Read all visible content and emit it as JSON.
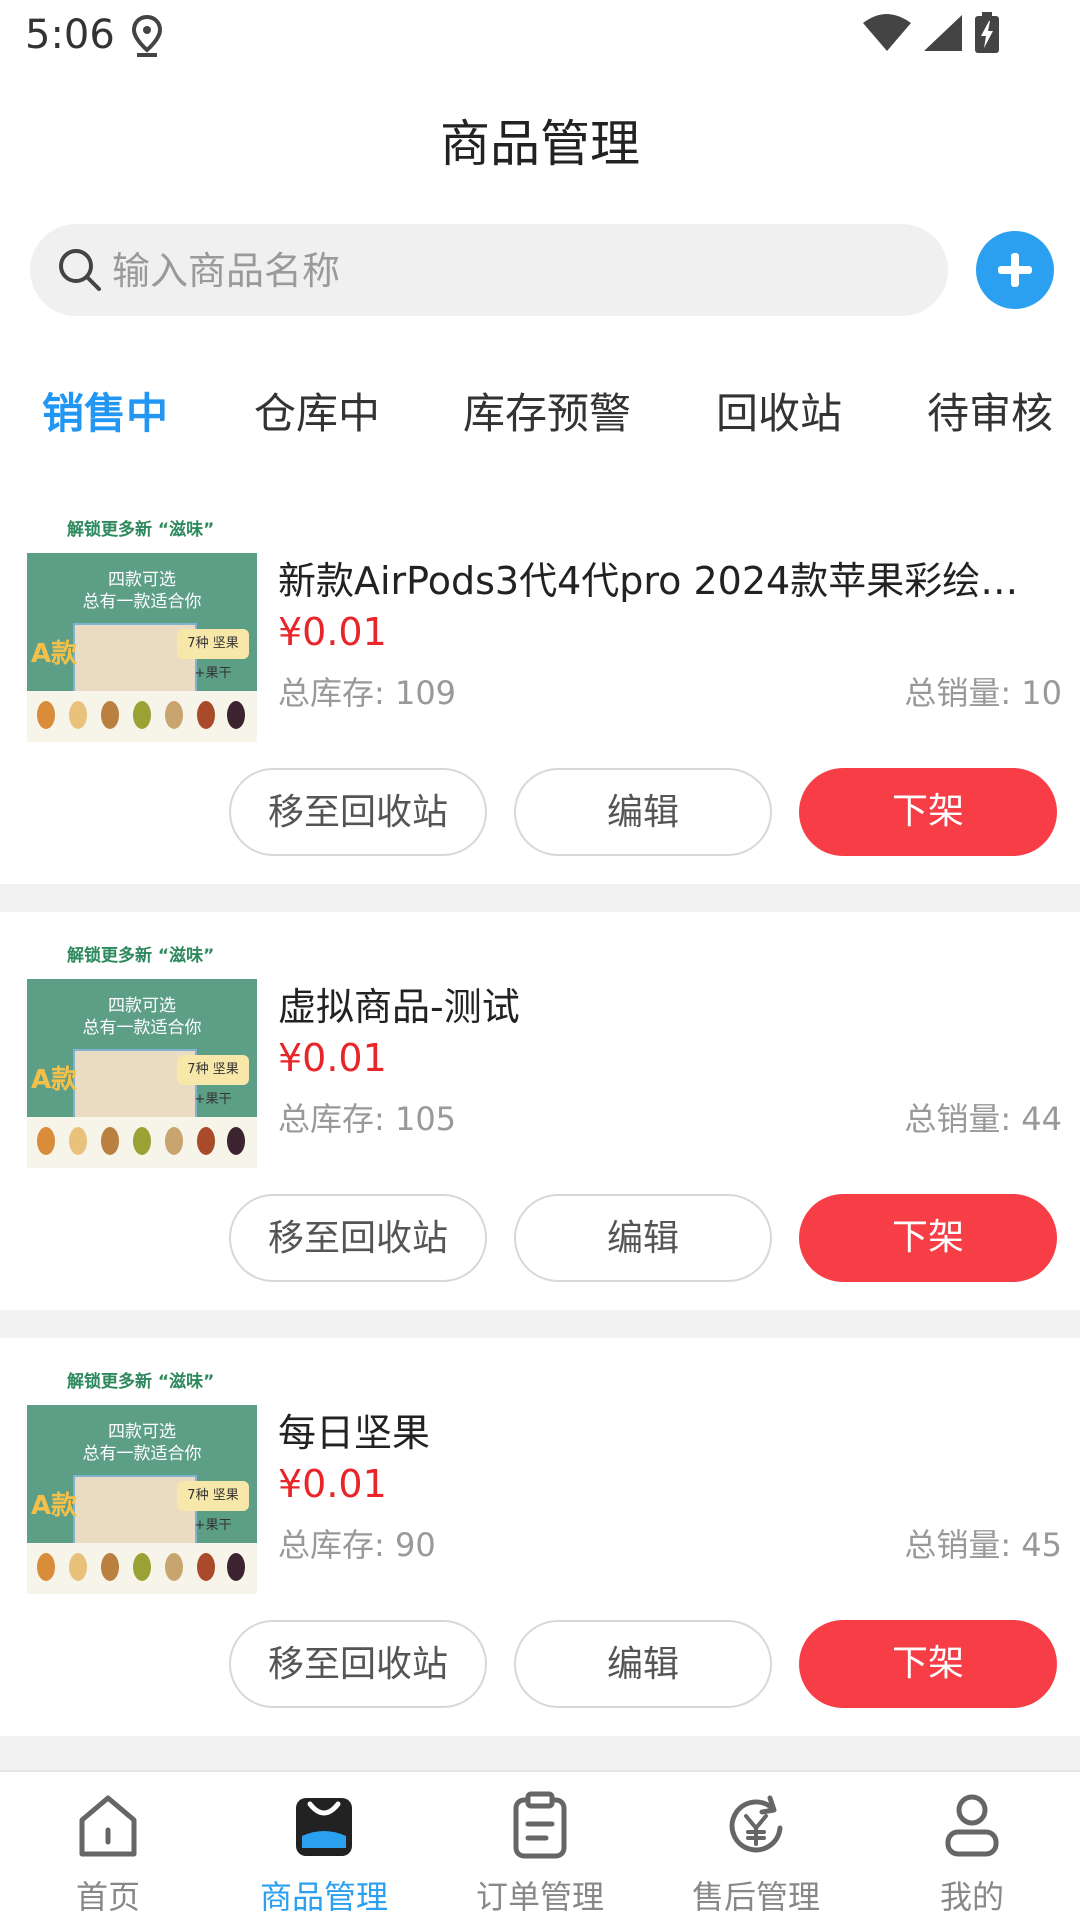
{
  "status_bar": {
    "time": "5:06"
  },
  "header": {
    "title": "商品管理"
  },
  "search": {
    "placeholder": "输入商品名称"
  },
  "tabs": [
    {
      "label": "销售中",
      "active": true
    },
    {
      "label": "仓库中",
      "active": false
    },
    {
      "label": "库存预警",
      "active": false
    },
    {
      "label": "回收站",
      "active": false
    },
    {
      "label": "待审核",
      "active": false
    }
  ],
  "thumbnail_text": {
    "top": "解锁更多新 “滋味”",
    "line1": "四款可选",
    "line2": "总有一款适合你",
    "variant": "A款",
    "tag": "7种 坚果+果干"
  },
  "products": [
    {
      "name": "新款AirPods3代4代pro 2024款苹果彩绘音...",
      "price": "¥0.01",
      "stock": "总库存: 109",
      "sales": "总销量: 10",
      "btn_recycle": "移至回收站",
      "btn_edit": "编辑",
      "btn_off": "下架"
    },
    {
      "name": "虚拟商品-测试",
      "price": "¥0.01",
      "stock": "总库存: 105",
      "sales": "总销量: 44",
      "btn_recycle": "移至回收站",
      "btn_edit": "编辑",
      "btn_off": "下架"
    },
    {
      "name": "每日坚果",
      "price": "¥0.01",
      "stock": "总库存: 90",
      "sales": "总销量: 45",
      "btn_recycle": "移至回收站",
      "btn_edit": "编辑",
      "btn_off": "下架"
    }
  ],
  "bottom_nav": [
    {
      "label": "首页",
      "icon": "home-icon",
      "active": false
    },
    {
      "label": "商品管理",
      "icon": "shopping-bag-icon",
      "active": true
    },
    {
      "label": "订单管理",
      "icon": "clipboard-icon",
      "active": false
    },
    {
      "label": "售后管理",
      "icon": "refund-yen-icon",
      "active": false
    },
    {
      "label": "我的",
      "icon": "user-icon",
      "active": false
    }
  ],
  "colors": {
    "accent": "#2b9ff0",
    "tab_active": "#2196f3",
    "price": "#e8262a",
    "offshelf_button": "#f73d45"
  }
}
